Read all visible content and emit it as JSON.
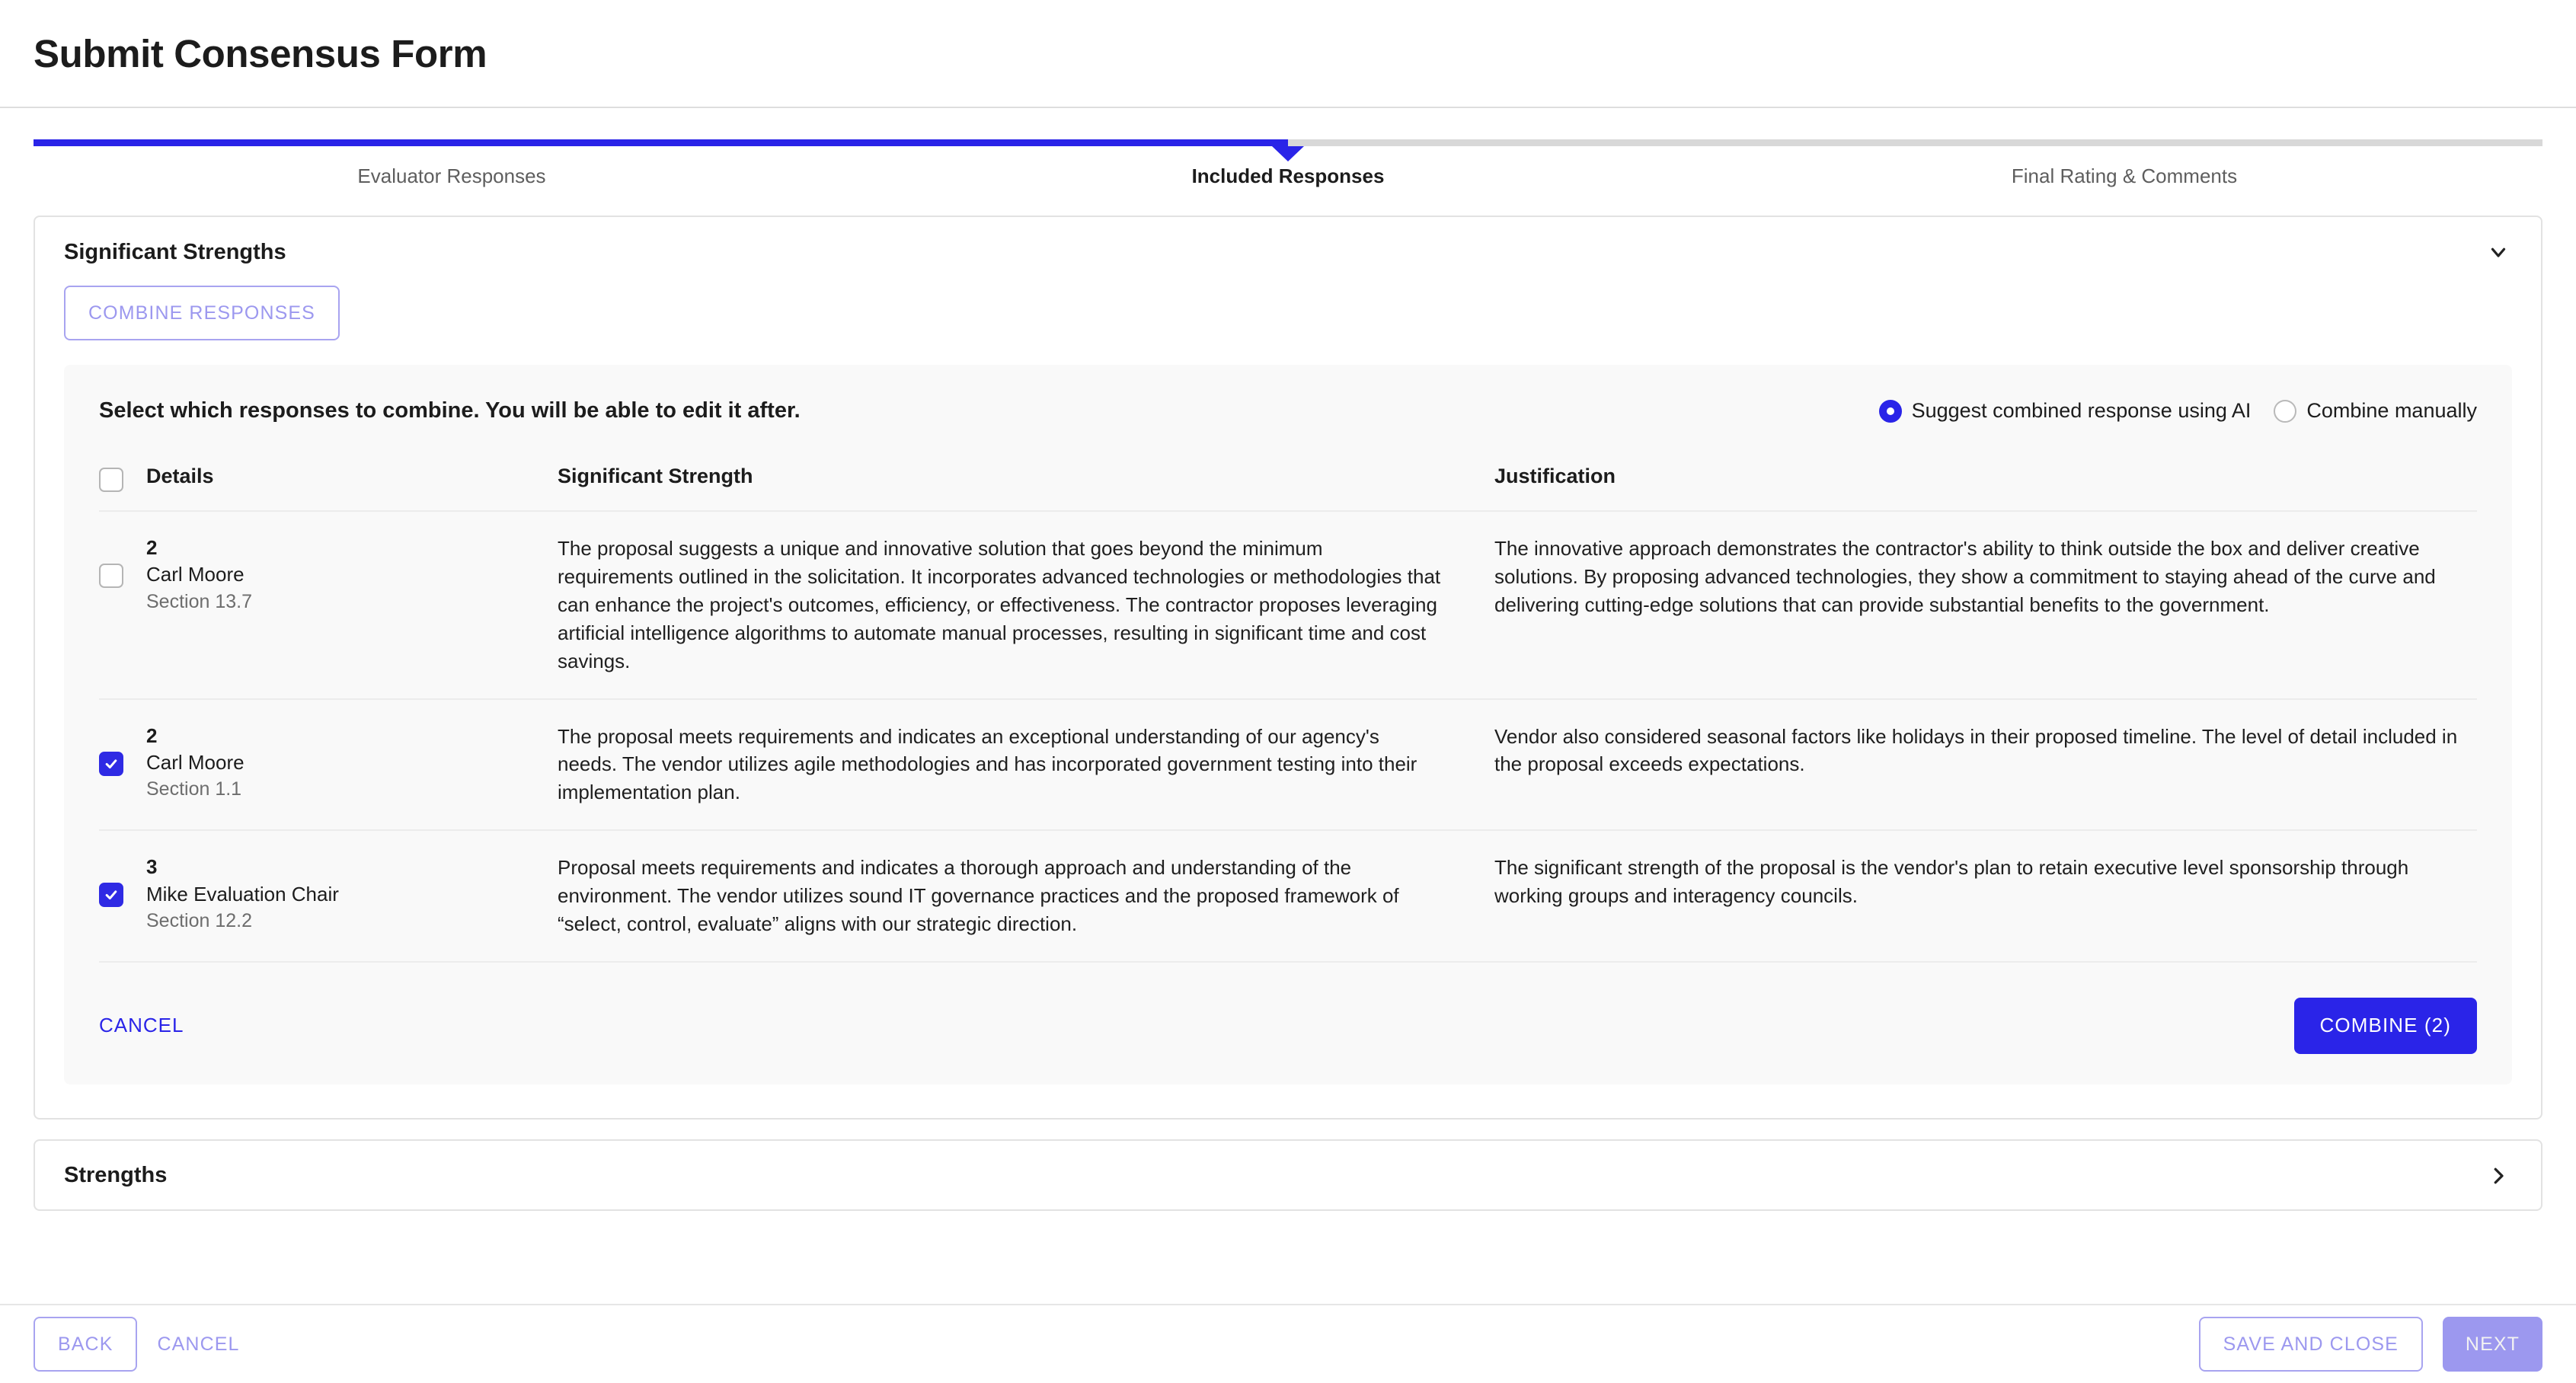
{
  "header": {
    "title": "Submit Consensus Form"
  },
  "stepper": {
    "steps": [
      {
        "label": "Evaluator Responses",
        "state": "complete"
      },
      {
        "label": "Included Responses",
        "state": "active"
      },
      {
        "label": "Final Rating & Comments",
        "state": "upcoming"
      }
    ],
    "progress_percent": 50,
    "fill_color": "#2a24e8",
    "track_color": "#d8d8d8"
  },
  "sections": {
    "significant_strengths": {
      "title": "Significant Strengths",
      "expanded": true,
      "chevron": "chevron-down-icon",
      "combine_responses_label": "COMBINE RESPONSES",
      "panel": {
        "prompt": "Select which responses to combine. You will be able to edit it after.",
        "options": [
          {
            "label": "Suggest combined response using AI",
            "selected": true
          },
          {
            "label": "Combine manually",
            "selected": false
          }
        ],
        "columns": {
          "details": "Details",
          "strength": "Significant Strength",
          "justification": "Justification"
        },
        "select_all_checked": false,
        "rows": [
          {
            "checked": false,
            "number": "2",
            "name": "Carl Moore",
            "section": "Section 13.7",
            "strength": "The proposal suggests a unique and innovative solution that goes beyond the minimum requirements outlined in the solicitation. It incorporates advanced technologies or methodologies that can enhance the project's outcomes, efficiency, or effectiveness. The contractor proposes leveraging artificial intelligence algorithms to automate manual processes, resulting in significant time and cost savings.",
            "justification": "The innovative approach demonstrates the contractor's ability to think outside the box and deliver creative solutions. By proposing advanced technologies, they show a commitment to staying ahead of the curve and delivering cutting-edge solutions that can provide substantial benefits to the government."
          },
          {
            "checked": true,
            "number": "2",
            "name": "Carl Moore",
            "section": "Section 1.1",
            "strength": "The proposal meets requirements and indicates an exceptional understanding of our agency's needs. The vendor utilizes agile methodologies and has incorporated government testing into their implementation plan.",
            "justification": "Vendor also considered seasonal factors like holidays in their proposed timeline. The level of detail included in the proposal exceeds expectations."
          },
          {
            "checked": true,
            "number": "3",
            "name": "Mike Evaluation Chair",
            "section": "Section 12.2",
            "strength": "Proposal meets requirements and indicates a thorough approach and understanding of the environment. The vendor utilizes sound IT governance practices and the proposed framework of “select, control, evaluate” aligns with our strategic direction.",
            "justification": "The significant strength of the proposal is the vendor's plan to retain executive level sponsorship through working groups and interagency councils."
          }
        ],
        "cancel_label": "CANCEL",
        "combine_label": "COMBINE (2)"
      }
    },
    "strengths": {
      "title": "Strengths",
      "expanded": false,
      "chevron": "chevron-right-icon"
    }
  },
  "footer": {
    "back_label": "BACK",
    "cancel_label": "CANCEL",
    "save_and_close_label": "SAVE AND CLOSE",
    "next_label": "NEXT"
  },
  "colors": {
    "accent": "#2a24e8",
    "accent_muted": "#9c98ef",
    "checkbox_checked": "#2f2ae4",
    "panel_bg": "#f9f9f9"
  }
}
